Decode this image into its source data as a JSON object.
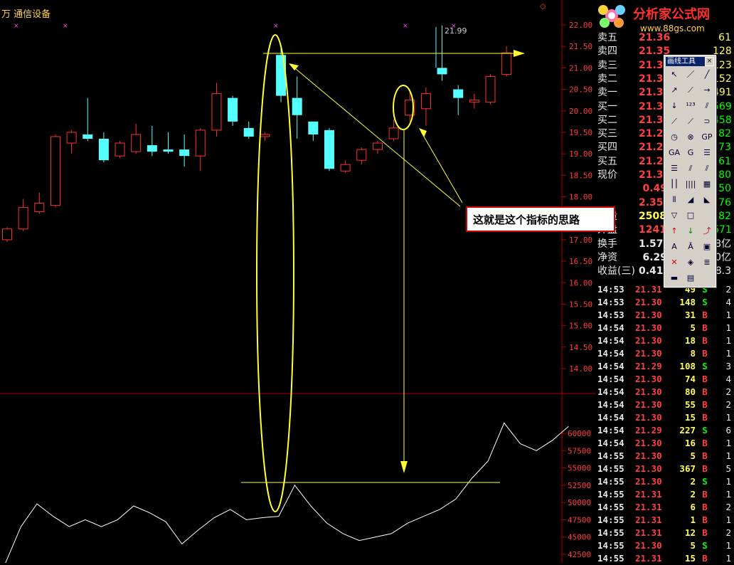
{
  "header": {
    "title": "万 通信设备"
  },
  "annotation": {
    "callout_text": "这就是这个指标的思路",
    "high_label": "21.99"
  },
  "logo": {
    "name": "分析家公式网",
    "url_text": "www.88gs.com"
  },
  "price_axis": [
    "22.00",
    "21.50",
    "21.00",
    "20.50",
    "20.00",
    "19.50",
    "19.00",
    "18.50",
    "18.00",
    "17.50",
    "17.00",
    "16.50",
    "16.00",
    "15.50",
    "15.00",
    "14.50",
    "14.00"
  ],
  "volume_axis": [
    "60000",
    "57500",
    "55000",
    "52500",
    "50000",
    "47500",
    "45000",
    "42500"
  ],
  "quote": {
    "rows": [
      {
        "label": "卖五",
        "value": "21.36",
        "vol": "61",
        "color": "#ff4040"
      },
      {
        "label": "卖四",
        "value": "21.35",
        "vol": "128",
        "color": "#ff4040"
      },
      {
        "label": "卖三",
        "value": "21.34",
        "vol": "123",
        "color": "#ff4040"
      },
      {
        "label": "卖二",
        "value": "21.33",
        "vol": "152",
        "color": "#ff4040"
      },
      {
        "label": "卖一",
        "value": "21.32",
        "vol": "491",
        "color": "#ff4040"
      },
      {
        "label": "买一",
        "value": "21.31",
        "vol": "569",
        "color": "#ff4040"
      },
      {
        "label": "买二",
        "value": "21.30",
        "vol": "458",
        "color": "#ff4040"
      },
      {
        "label": "买三",
        "value": "21.29",
        "vol": "82",
        "color": "#ff4040"
      },
      {
        "label": "买四",
        "value": "21.28",
        "vol": "73",
        "color": "#ff4040"
      },
      {
        "label": "买五",
        "value": "21.27",
        "vol": "61",
        "color": "#ff4040"
      },
      {
        "label": "现价",
        "value": "21.31",
        "vol": "80",
        "color": "#ff4040"
      },
      {
        "label": "",
        "value": "0.49",
        "vol": "50",
        "color": "#ff4040"
      },
      {
        "label": "",
        "value": "2.35%",
        "vol": "76",
        "color": "#ff4040"
      },
      {
        "label": "总量",
        "value": "25085",
        "vol": "82",
        "color": "#ffff55"
      },
      {
        "label": "外盘",
        "value": "12414",
        "vol": "671",
        "color": "#ff4040"
      },
      {
        "label": "换手",
        "value": "1.57%",
        "vol": "8亿",
        "color": "#e8e8e8"
      },
      {
        "label": "净资",
        "value": "6.29",
        "vol": "0亿",
        "color": "#e8e8e8"
      },
      {
        "label": "收益(三)",
        "value": "0.417",
        "vol": "8.3",
        "color": "#e8e8e8"
      }
    ]
  },
  "trades": [
    {
      "time": "14:53",
      "price": "21.31",
      "vol": "49",
      "side": "S",
      "cnt": "2"
    },
    {
      "time": "14:53",
      "price": "21.30",
      "vol": "148",
      "side": "S",
      "cnt": "4"
    },
    {
      "time": "14:53",
      "price": "21.30",
      "vol": "31",
      "side": "B",
      "cnt": "1"
    },
    {
      "time": "14:54",
      "price": "21.30",
      "vol": "5",
      "side": "B",
      "cnt": "1"
    },
    {
      "time": "14:54",
      "price": "21.30",
      "vol": "18",
      "side": "B",
      "cnt": "1"
    },
    {
      "time": "14:54",
      "price": "21.30",
      "vol": "8",
      "side": "B",
      "cnt": "1"
    },
    {
      "time": "14:54",
      "price": "21.29",
      "vol": "108",
      "side": "S",
      "cnt": "3"
    },
    {
      "time": "14:54",
      "price": "21.30",
      "vol": "74",
      "side": "B",
      "cnt": "4"
    },
    {
      "time": "14:54",
      "price": "21.30",
      "vol": "80",
      "side": "B",
      "cnt": "2"
    },
    {
      "time": "14:54",
      "price": "21.30",
      "vol": "55",
      "side": "B",
      "cnt": "2"
    },
    {
      "time": "14:54",
      "price": "21.30",
      "vol": "15",
      "side": "B",
      "cnt": "1"
    },
    {
      "time": "14:54",
      "price": "21.29",
      "vol": "227",
      "side": "S",
      "cnt": "6"
    },
    {
      "time": "14:54",
      "price": "21.30",
      "vol": "16",
      "side": "B",
      "cnt": "1"
    },
    {
      "time": "14:55",
      "price": "21.30",
      "vol": "5",
      "side": "B",
      "cnt": "1"
    },
    {
      "time": "14:55",
      "price": "21.30",
      "vol": "367",
      "side": "B",
      "cnt": "5"
    },
    {
      "time": "14:55",
      "price": "21.30",
      "vol": "2",
      "side": "S",
      "cnt": "1"
    },
    {
      "time": "14:55",
      "price": "21.31",
      "vol": "2",
      "side": "B",
      "cnt": "1"
    },
    {
      "time": "14:55",
      "price": "21.31",
      "vol": "6",
      "side": "B",
      "cnt": "2"
    },
    {
      "time": "14:55",
      "price": "21.31",
      "vol": "1",
      "side": "B",
      "cnt": "1"
    },
    {
      "time": "14:55",
      "price": "21.31",
      "vol": "12",
      "side": "B",
      "cnt": "2"
    },
    {
      "time": "14:55",
      "price": "21.30",
      "vol": "5",
      "side": "S",
      "cnt": "1"
    },
    {
      "time": "14:55",
      "price": "21.31",
      "vol": "15",
      "side": "B",
      "cnt": "1"
    }
  ],
  "toolbox": {
    "title": "画线工具",
    "close": "×",
    "tools": [
      "pointer-icon",
      "line-icon",
      "ray-icon",
      "segment-icon",
      "parallel-icon",
      "arrow-line-icon",
      "vertical-line-icon",
      "count-icon",
      "channel-icon",
      "fan-icon",
      "gann-icon",
      "arc-icon",
      "circle-icon",
      "ellipse-icon",
      "gp-icon",
      "ga-icon",
      "g-icon",
      "retrace-icon",
      "fibo-icon",
      "speed-icon",
      "gann-fan-icon",
      "cycle-icon",
      "time-icon",
      "regression-icon",
      "bar-icon",
      "fork-icon",
      "angle-icon",
      "triangle-icon",
      "rectangle-icon",
      "",
      "up-arrow-icon",
      "down-arrow-icon",
      "buy-icon",
      "text-icon",
      "font-icon",
      "select-icon",
      "delete-icon",
      "hide-icon",
      "list-icon",
      "ruler-icon",
      "save-icon",
      ""
    ]
  },
  "chart_data": [
    {
      "type": "candlestick",
      "title": "",
      "y_axis": "price",
      "ylim": [
        13.8,
        22.2
      ],
      "candles": [
        {
          "o": 17.0,
          "c": 17.25,
          "h": 17.3,
          "l": 16.95
        },
        {
          "o": 17.25,
          "c": 17.75,
          "h": 17.95,
          "l": 17.2
        },
        {
          "o": 17.65,
          "c": 17.85,
          "h": 18.1,
          "l": 17.6
        },
        {
          "o": 17.8,
          "c": 19.4,
          "h": 19.45,
          "l": 17.75
        },
        {
          "o": 19.25,
          "c": 19.5,
          "h": 19.55,
          "l": 19.0
        },
        {
          "o": 19.45,
          "c": 19.35,
          "h": 20.3,
          "l": 19.3
        },
        {
          "o": 19.35,
          "c": 18.85,
          "h": 19.5,
          "l": 18.8
        },
        {
          "o": 18.95,
          "c": 19.25,
          "h": 19.3,
          "l": 18.9
        },
        {
          "o": 19.05,
          "c": 19.45,
          "h": 19.7,
          "l": 19.0
        },
        {
          "o": 19.2,
          "c": 19.05,
          "h": 19.65,
          "l": 18.95
        },
        {
          "o": 19.1,
          "c": 19.05,
          "h": 19.5,
          "l": 19.0
        },
        {
          "o": 19.1,
          "c": 18.95,
          "h": 19.45,
          "l": 18.7
        },
        {
          "o": 18.95,
          "c": 19.55,
          "h": 19.6,
          "l": 18.6
        },
        {
          "o": 19.55,
          "c": 20.4,
          "h": 20.65,
          "l": 19.4
        },
        {
          "o": 20.3,
          "c": 19.75,
          "h": 20.35,
          "l": 19.65
        },
        {
          "o": 19.6,
          "c": 19.4,
          "h": 19.75,
          "l": 19.35
        },
        {
          "o": 19.4,
          "c": 19.45,
          "h": 19.5,
          "l": 19.3
        },
        {
          "o": 21.3,
          "c": 20.35,
          "h": 21.55,
          "l": 20.2
        },
        {
          "o": 20.3,
          "c": 19.9,
          "h": 20.8,
          "l": 19.35
        },
        {
          "o": 19.75,
          "c": 19.45,
          "h": 19.75,
          "l": 19.3
        },
        {
          "o": 19.55,
          "c": 18.65,
          "h": 19.6,
          "l": 18.6
        },
        {
          "o": 18.6,
          "c": 18.75,
          "h": 18.85,
          "l": 18.55
        },
        {
          "o": 18.85,
          "c": 19.1,
          "h": 19.15,
          "l": 18.75
        },
        {
          "o": 19.1,
          "c": 19.25,
          "h": 19.3,
          "l": 19.0
        },
        {
          "o": 19.35,
          "c": 19.6,
          "h": 19.8,
          "l": 19.3
        },
        {
          "o": 19.9,
          "c": 20.25,
          "h": 20.5,
          "l": 19.75
        },
        {
          "o": 20.05,
          "c": 20.4,
          "h": 20.55,
          "l": 19.65
        },
        {
          "o": 21.0,
          "c": 20.85,
          "h": 21.99,
          "l": 20.7
        },
        {
          "o": 20.5,
          "c": 20.3,
          "h": 20.6,
          "l": 19.9
        },
        {
          "o": 20.2,
          "c": 20.25,
          "h": 20.4,
          "l": 20.05
        },
        {
          "o": 20.2,
          "c": 20.8,
          "h": 20.85,
          "l": 20.15
        },
        {
          "o": 20.85,
          "c": 21.35,
          "h": 21.5,
          "l": 20.8
        }
      ]
    },
    {
      "type": "line",
      "title": "",
      "y_axis": "volume",
      "ylim": [
        41500,
        62500
      ],
      "x": [
        0,
        1,
        2,
        3,
        4,
        5,
        6,
        7,
        8,
        9,
        10,
        11,
        12,
        13,
        14,
        15,
        16,
        17,
        18,
        19,
        20,
        21,
        22,
        23,
        24,
        25,
        26,
        27,
        28,
        29,
        30,
        31
      ],
      "values": [
        41000,
        46500,
        49800,
        48000,
        46500,
        47500,
        46500,
        47500,
        49500,
        48500,
        47200,
        44000,
        46000,
        47800,
        49000,
        47500,
        47800,
        48000,
        52500,
        49500,
        47000,
        45500,
        44500,
        45000,
        45500,
        47000,
        48000,
        49000,
        50500,
        53500,
        56000,
        61500,
        58500,
        57500,
        59000,
        61000
      ]
    }
  ]
}
